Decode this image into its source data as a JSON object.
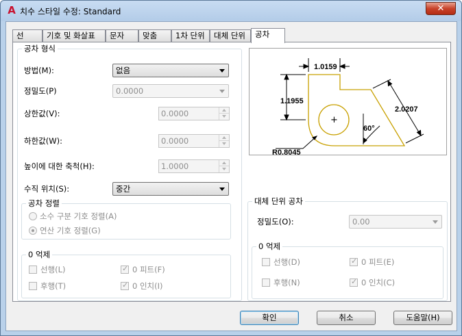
{
  "window": {
    "title": "치수 스타일 수정: Standard",
    "close_label": "✕"
  },
  "tabs": [
    {
      "label": "선"
    },
    {
      "label": "기호 및 화살표"
    },
    {
      "label": "문자"
    },
    {
      "label": "맞춤"
    },
    {
      "label": "1차 단위"
    },
    {
      "label": "대체 단위"
    },
    {
      "label": "공차"
    }
  ],
  "active_tab": "공차",
  "tolerance_format": {
    "title": "공차 형식",
    "method": {
      "label": "방법(M):",
      "value": "없음"
    },
    "precision": {
      "label": "정밀도(P)",
      "value": "0.0000"
    },
    "upper_value": {
      "label": "상한값(V):",
      "value": "0.0000"
    },
    "lower_value": {
      "label": "하한값(W):",
      "value": "0.0000"
    },
    "height_scale": {
      "label": "높이에 대한 축척(H):",
      "value": "1.0000"
    },
    "vertical_position": {
      "label": "수직 위치(S):",
      "value": "중간"
    }
  },
  "tolerance_alignment": {
    "title": "공차 정렬",
    "option_decimal": "소수 구분 기호 정렬(A)",
    "option_operator": "연산 기호 정렬(G)",
    "selected": "option_operator"
  },
  "zero_suppression": {
    "title": "0 억제",
    "leading": {
      "label": "선행(L)",
      "checked": false
    },
    "trailing": {
      "label": "후행(T)",
      "checked": false
    },
    "zero_feet": {
      "label": "0 피트(F)",
      "checked": true
    },
    "zero_inches": {
      "label": "0 인치(I)",
      "checked": true
    }
  },
  "preview": {
    "dim_top": "1.0159",
    "dim_left": "1.1955",
    "dim_right": "2.0207",
    "angle": "60°",
    "radius": "R0.8045",
    "center_mark": "+",
    "line_color": "#c8a000"
  },
  "alt_unit_tolerance": {
    "title": "대체 단위 공차",
    "precision": {
      "label": "정밀도(O):",
      "value": "0.00"
    }
  },
  "alt_zero_suppression": {
    "title": "0 억제",
    "leading": {
      "label": "선행(D)",
      "checked": false
    },
    "trailing": {
      "label": "후행(N)",
      "checked": false
    },
    "zero_feet": {
      "label": "0 피트(E)",
      "checked": true
    },
    "zero_inches": {
      "label": "0 인치(C)",
      "checked": true
    }
  },
  "buttons": {
    "ok": "확인",
    "cancel": "취소",
    "help": "도움말(H)"
  }
}
